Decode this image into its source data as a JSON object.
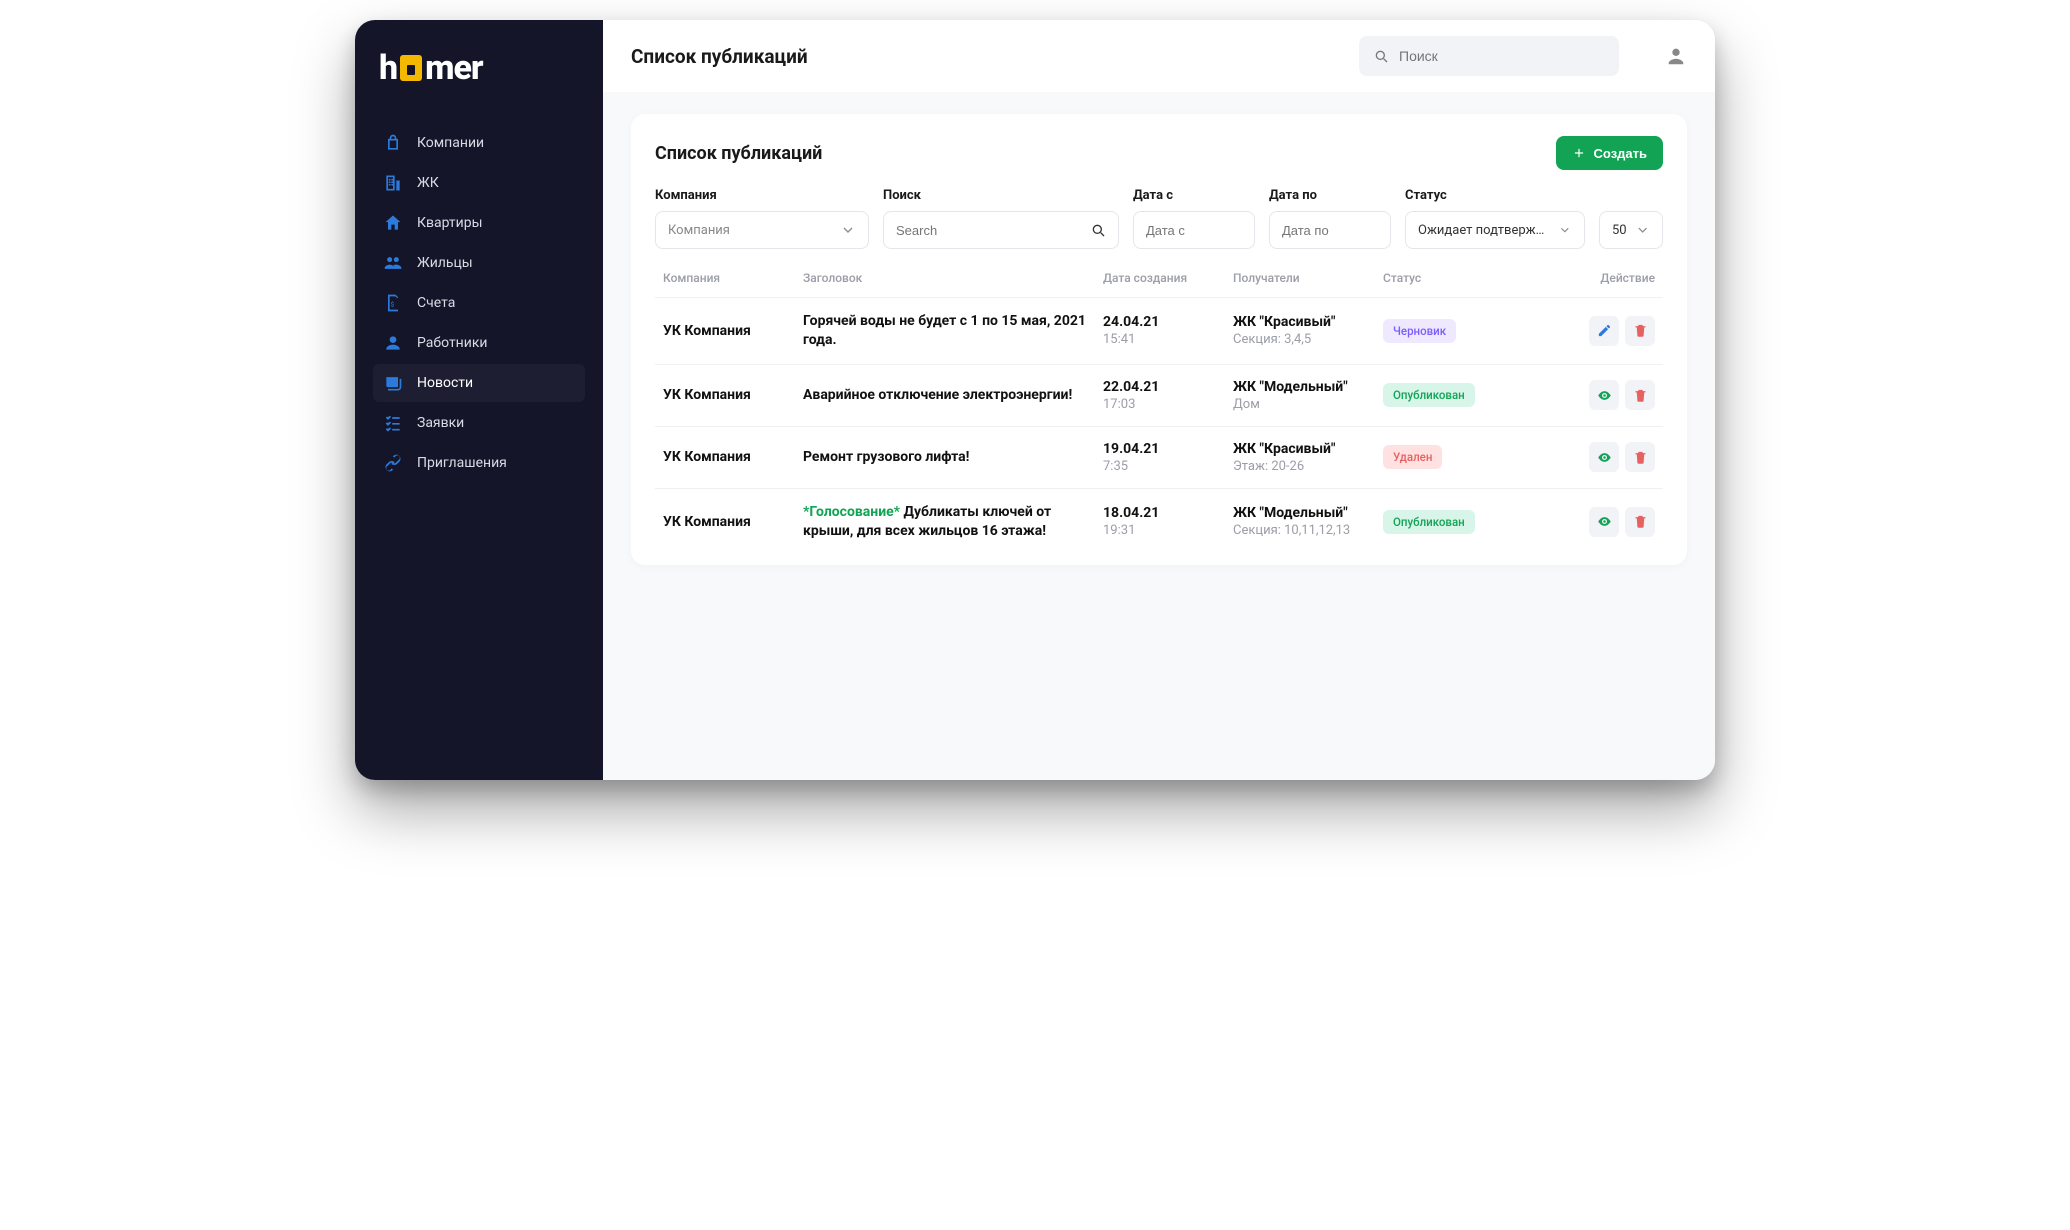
{
  "brand": {
    "part1": "h",
    "part2": "mer"
  },
  "sidebar": {
    "items": [
      {
        "label": "Компании",
        "icon": "company-icon"
      },
      {
        "label": "ЖК",
        "icon": "building-icon"
      },
      {
        "label": "Квартиры",
        "icon": "home-icon"
      },
      {
        "label": "Жильцы",
        "icon": "people-icon"
      },
      {
        "label": "Счета",
        "icon": "invoice-icon"
      },
      {
        "label": "Работники",
        "icon": "worker-icon"
      },
      {
        "label": "Новости",
        "icon": "news-icon",
        "active": true
      },
      {
        "label": "Заявки",
        "icon": "tasks-icon"
      },
      {
        "label": "Приглашения",
        "icon": "link-icon"
      }
    ]
  },
  "topbar": {
    "title": "Список публикаций",
    "search_placeholder": "Поиск"
  },
  "card": {
    "title": "Список публикаций",
    "create_label": "Создать"
  },
  "filters": {
    "company": {
      "label": "Компания",
      "placeholder": "Компания"
    },
    "search": {
      "label": "Поиск",
      "placeholder": "Search"
    },
    "dateFrom": {
      "label": "Дата с",
      "placeholder": "Дата с"
    },
    "dateTo": {
      "label": "Дата по",
      "placeholder": "Дата по"
    },
    "status": {
      "label": "Статус",
      "value": "Ожидает подтверждения"
    },
    "perPage": {
      "value": "50"
    }
  },
  "columns": {
    "company": "Компания",
    "title": "Заголовок",
    "created": "Дата создания",
    "recipients": "Получатели",
    "status": "Статус",
    "action": "Действие"
  },
  "status_styles": {
    "Черновик": {
      "bg": "#efe9ff",
      "fg": "#7a5cff"
    },
    "Опубликован": {
      "bg": "#d8f5ea",
      "fg": "#12a454"
    },
    "Удален": {
      "bg": "#ffe1e1",
      "fg": "#e76161"
    }
  },
  "rows": [
    {
      "company": "УК Компания",
      "title_prefix": "",
      "title": "Горячей воды не будет с 1 по 15 мая, 2021 года.",
      "date": "24.04.21",
      "time": "15:41",
      "recipient_main": "ЖК \"Красивый\"",
      "recipient_sub": "Секция: 3,4,5",
      "status": "Черновик",
      "actions": [
        "edit",
        "delete"
      ]
    },
    {
      "company": "УК Компания",
      "title_prefix": "",
      "title": "Аварийное отключение электроэнергии!",
      "date": "22.04.21",
      "time": "17:03",
      "recipient_main": "ЖК \"Модельный\"",
      "recipient_sub": "Дом",
      "status": "Опубликован",
      "actions": [
        "view",
        "delete"
      ]
    },
    {
      "company": "УК Компания",
      "title_prefix": "",
      "title": "Ремонт грузового лифта!",
      "date": "19.04.21",
      "time": "7:35",
      "recipient_main": "ЖК \"Красивый\"",
      "recipient_sub": "Этаж: 20-26",
      "status": "Удален",
      "actions": [
        "view",
        "delete"
      ]
    },
    {
      "company": "УК Компания",
      "title_prefix": "*Голосование* ",
      "title": "Дубликаты ключей от крыши, для всех жильцов 16 этажа!",
      "date": "18.04.21",
      "time": "19:31",
      "recipient_main": "ЖК \"Модельный\"",
      "recipient_sub": "Секция: 10,11,12,13",
      "status": "Опубликован",
      "actions": [
        "view",
        "delete"
      ]
    }
  ]
}
